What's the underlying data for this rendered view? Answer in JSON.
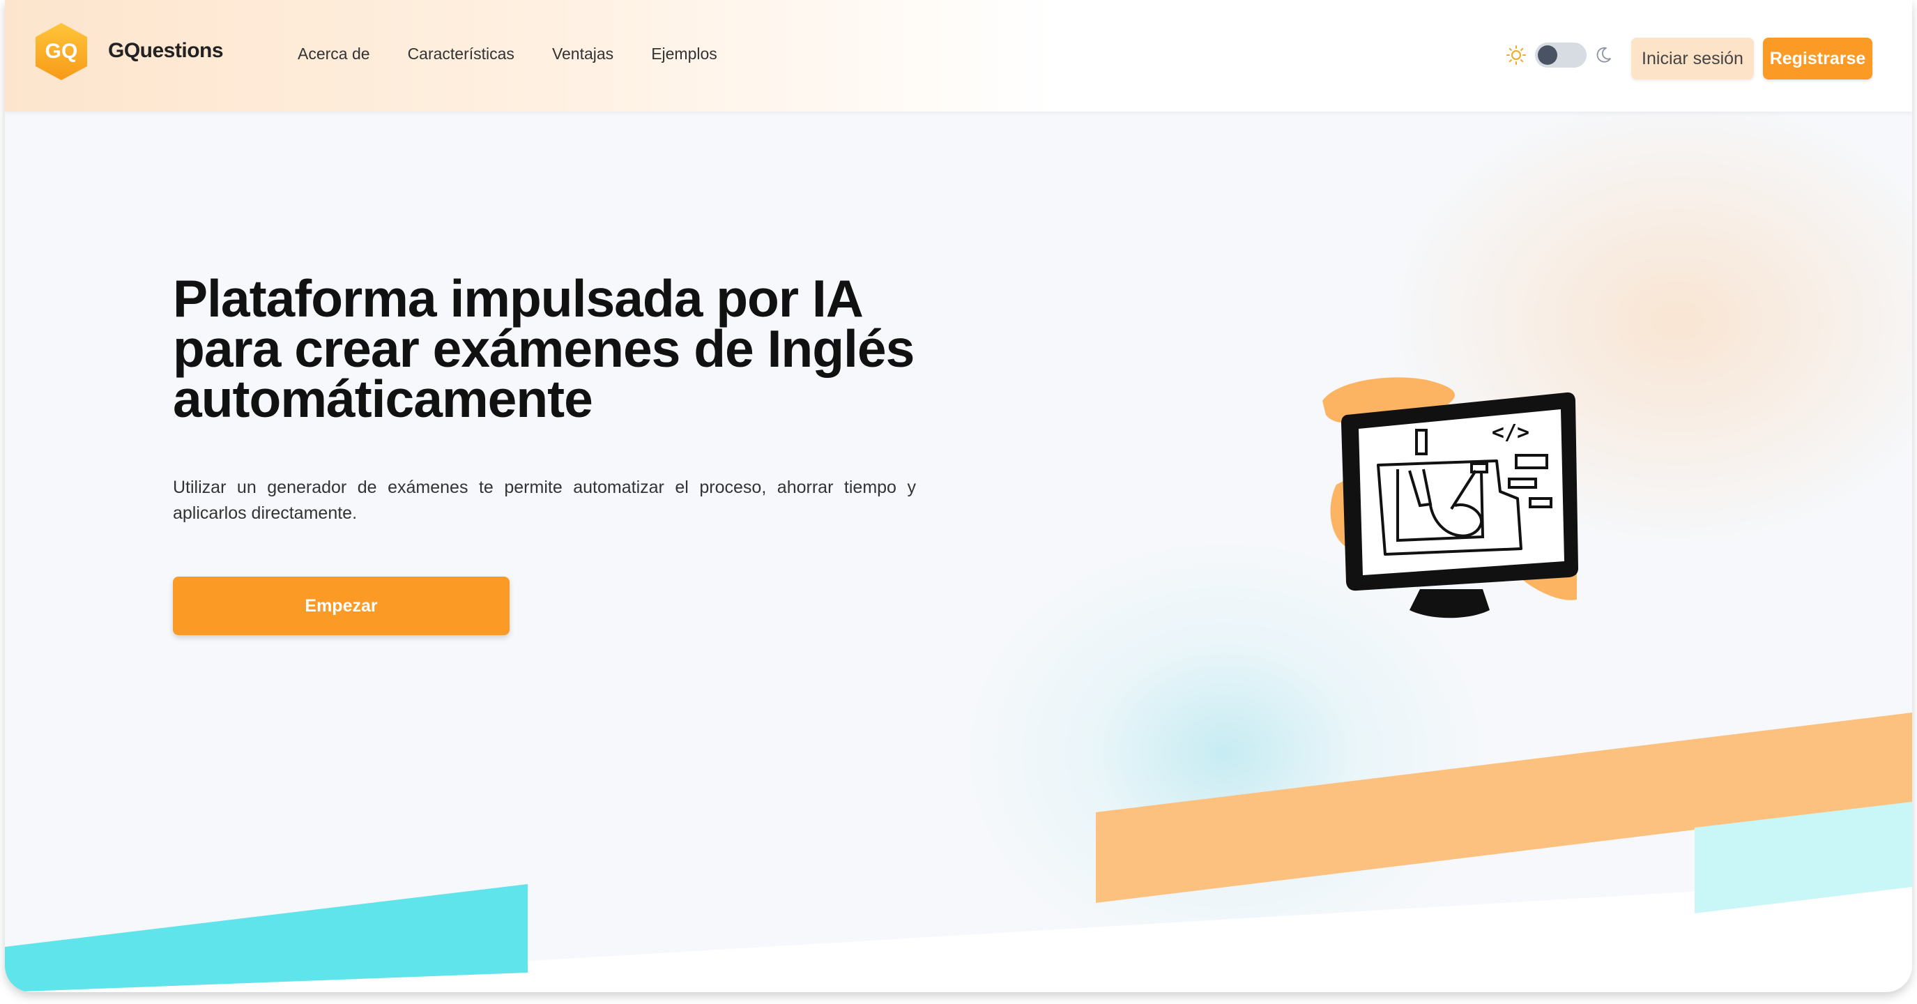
{
  "header": {
    "logo_text": "GQ",
    "brand": "GQuestions",
    "nav": [
      "Acerca de",
      "Características",
      "Ventajas",
      "Ejemplos"
    ],
    "theme_toggle": {
      "icons": [
        "sun-icon",
        "moon-icon"
      ],
      "state": "light"
    },
    "login_label": "Iniciar sesión",
    "signup_label": "Registrarse"
  },
  "hero": {
    "title_lines": [
      "Plataforma impulsada por IA",
      "para crear exámenes de Inglés",
      "automáticamente"
    ],
    "description": "Utilizar un generador de exámenes te permite automatizar el proceso, ahorrar tiempo y aplicarlos directamente.",
    "cta_label": "Empezar",
    "illustration_icon": "computer-code-illustration",
    "code_tag": "</>"
  },
  "colors": {
    "accent": "#fb9a24",
    "accent_light": "#fde3c8",
    "peach_band": "#fcc07f",
    "cyan_band": "#5ee4ea",
    "light_cyan_band": "#c9f6f7",
    "text_dark": "#111111"
  }
}
